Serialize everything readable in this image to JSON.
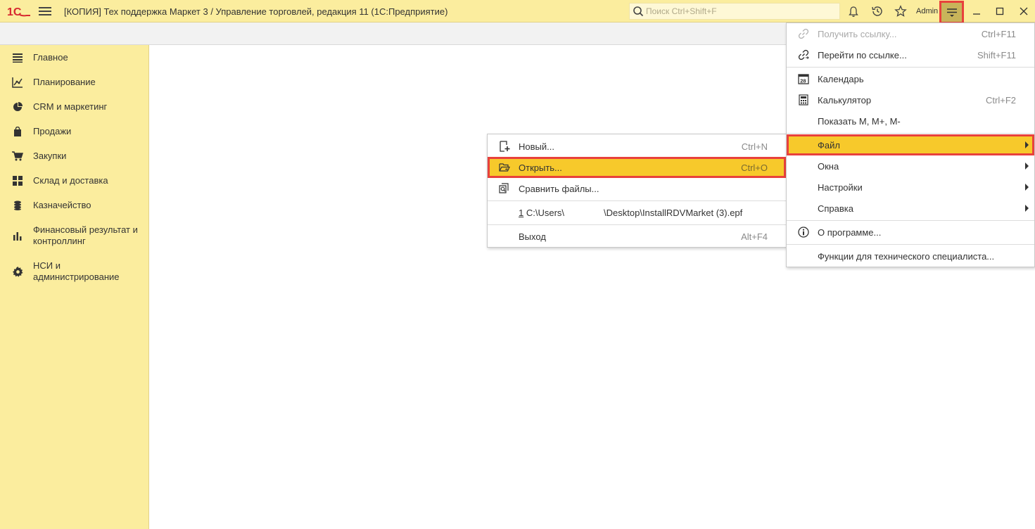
{
  "window": {
    "title": "[КОПИЯ] Тех поддержка Маркет 3 / Управление торговлей, редакция 11  (1С:Предприятие)",
    "search_placeholder": "Поиск Ctrl+Shift+F",
    "user": "Admin",
    "logo_text": "1С"
  },
  "sidebar": {
    "items": [
      {
        "label": "Главное",
        "icon": "list-icon"
      },
      {
        "label": "Планирование",
        "icon": "chart-line-icon"
      },
      {
        "label": "CRM и маркетинг",
        "icon": "pie-chart-icon"
      },
      {
        "label": "Продажи",
        "icon": "shopping-bag-icon"
      },
      {
        "label": "Закупки",
        "icon": "cart-icon"
      },
      {
        "label": "Склад и доставка",
        "icon": "grid-icon"
      },
      {
        "label": "Казначейство",
        "icon": "coins-icon"
      },
      {
        "label": "Финансовый результат и контроллинг",
        "icon": "bar-chart-icon"
      },
      {
        "label": "НСИ и администрирование",
        "icon": "gear-icon"
      }
    ]
  },
  "main_menu": {
    "items": [
      {
        "label": "Получить ссылку...",
        "shortcut": "Ctrl+F11",
        "icon": "link-icon",
        "disabled": true
      },
      {
        "label": "Перейти по ссылке...",
        "shortcut": "Shift+F11",
        "icon": "goto-link-icon"
      },
      {
        "label": "Календарь",
        "shortcut": "",
        "icon": "calendar-icon",
        "calendar_day": "28"
      },
      {
        "label": "Калькулятор",
        "shortcut": "Ctrl+F2",
        "icon": "calculator-icon"
      },
      {
        "label": "Показать M, M+, M-",
        "shortcut": ""
      },
      {
        "label": "Файл",
        "submenu": true,
        "highlighted": true
      },
      {
        "label": "Окна",
        "submenu": true
      },
      {
        "label": "Настройки",
        "submenu": true
      },
      {
        "label": "Справка",
        "submenu": true
      },
      {
        "label": "О программе...",
        "icon": "info-icon"
      },
      {
        "label": "Функции для технического специалиста..."
      }
    ]
  },
  "file_menu": {
    "items": [
      {
        "label": "Новый...",
        "shortcut": "Ctrl+N",
        "icon": "new-file-icon"
      },
      {
        "label": "Открыть...",
        "shortcut": "Ctrl+O",
        "icon": "open-folder-icon",
        "highlighted": true
      },
      {
        "label": "Сравнить файлы...",
        "shortcut": "",
        "icon": "compare-files-icon"
      },
      {
        "label_num": "1",
        "label_path_a": " C:\\Users\\",
        "label_path_b": "\\Desktop\\InstallRDVMarket (3).epf"
      },
      {
        "label": "Выход",
        "shortcut": "Alt+F4"
      }
    ]
  },
  "colors": {
    "panel_yellow": "#fbed9e",
    "highlight_yellow": "#f7c92b",
    "annotation_red": "#e8413c",
    "logo_red": "#d7282f"
  }
}
